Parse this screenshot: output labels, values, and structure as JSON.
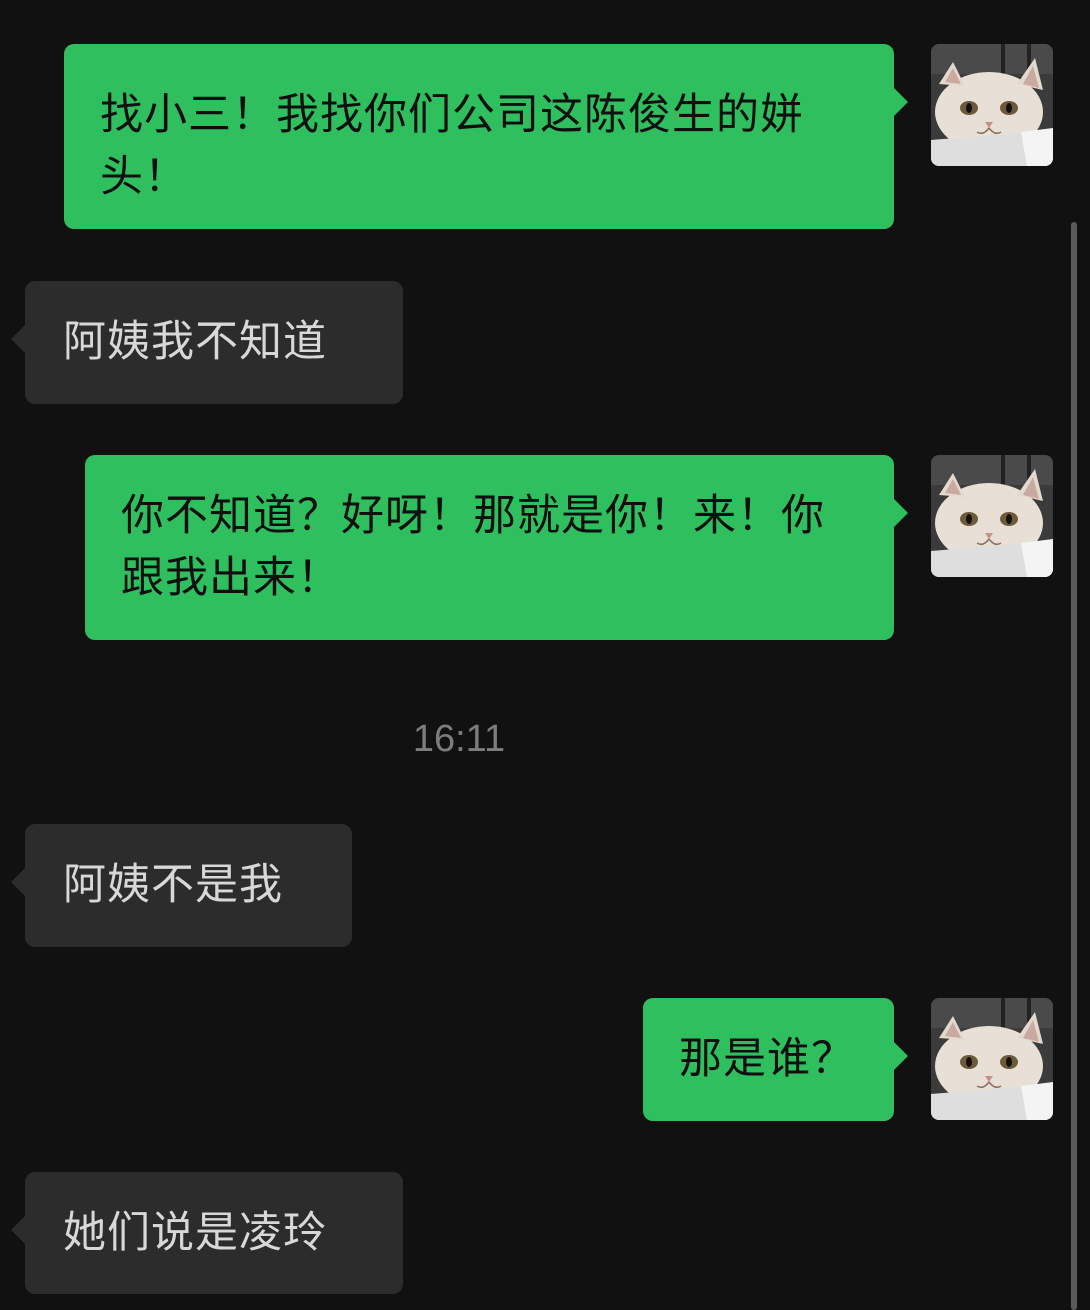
{
  "messages": [
    {
      "side": "out",
      "text": "找小三！我找你们公司这陈俊生的姘头！"
    },
    {
      "side": "in",
      "text": "阿姨我不知道"
    },
    {
      "side": "out",
      "text": "你不知道？好呀！那就是你！来！你跟我出来！"
    },
    {
      "side": "in",
      "text": "阿姨不是我"
    },
    {
      "side": "out",
      "text": "那是谁？"
    },
    {
      "side": "in",
      "text": "她们说是凌玲"
    }
  ],
  "timestamp": "16:11",
  "avatar_icon": "cat-face-icon",
  "colors": {
    "background": "#111111",
    "outgoing_bubble": "#2fbf5f",
    "incoming_bubble": "#2c2c2c",
    "incoming_text": "#d8d8d8",
    "timestamp_text": "#7d7d7d"
  }
}
